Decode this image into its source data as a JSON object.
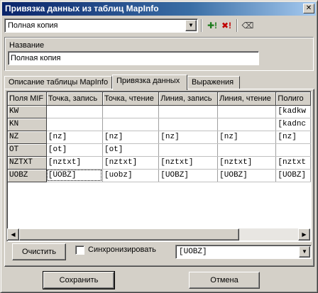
{
  "window": {
    "title": "Привязка данных из таблиц MapInfo",
    "close_glyph": "✕"
  },
  "toolbar": {
    "template_value": "Полная копия",
    "icons": [
      "add-icon",
      "delete-icon",
      "eraser-icon"
    ],
    "add_glyph": "✚!",
    "delete_glyph": "✖!",
    "eraser_glyph": "⌫"
  },
  "name_group": {
    "label": "Название",
    "value": "Полная копия"
  },
  "tabs": [
    {
      "label": "Описание таблицы  MapInfo"
    },
    {
      "label": "Привязка данных"
    },
    {
      "label": "Выражения"
    }
  ],
  "grid": {
    "headers": [
      "Поля MIF",
      "Точка, запись",
      "Точка, чтение",
      "Линия, запись",
      "Линия, чтение",
      "Полиго"
    ],
    "rows": [
      {
        "field": "KW",
        "cells": [
          "",
          "",
          "",
          "",
          "[kadkw"
        ]
      },
      {
        "field": "KN",
        "cells": [
          "",
          "",
          "",
          "",
          "[kadnc"
        ]
      },
      {
        "field": "NZ",
        "cells": [
          "[nz]",
          "[nz]",
          "[nz]",
          "[nz]",
          "[nz]"
        ]
      },
      {
        "field": "OT",
        "cells": [
          "[ot]",
          "[ot]",
          "",
          "",
          ""
        ]
      },
      {
        "field": "NZTXT",
        "cells": [
          "[nztxt]",
          "[nztxt]",
          "[nztxt]",
          "[nztxt]",
          "[nztxt"
        ]
      },
      {
        "field": "UOBZ",
        "cells": [
          "[UOBZ]",
          "[uobz]",
          "[UOBZ]",
          "[UOBZ]",
          "[UOBZ]"
        ]
      }
    ]
  },
  "bottom": {
    "clear_label": "Очистить",
    "sync_label": "Синхронизировать",
    "sync_checked": false,
    "field_value": "[UOBZ]"
  },
  "footer": {
    "save_label": "Сохранить",
    "cancel_label": "Отмена"
  }
}
